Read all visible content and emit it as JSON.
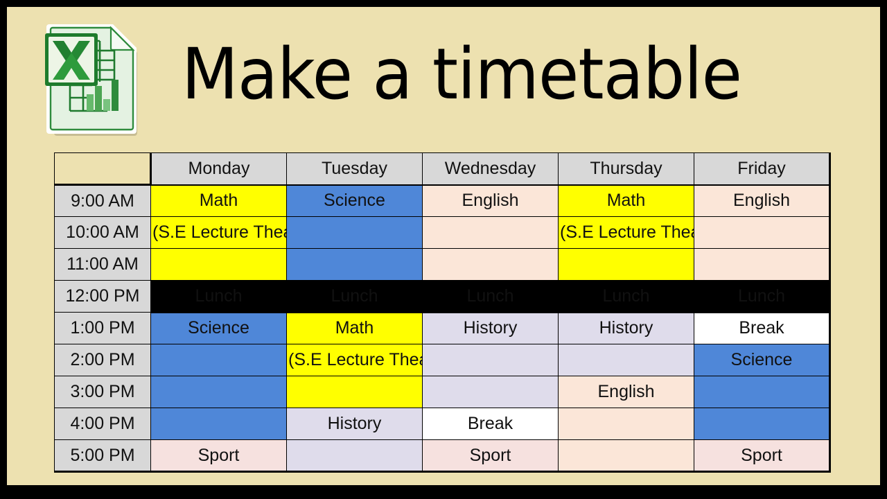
{
  "slide": {
    "background_color": "#EDE1B0",
    "frame_color": "#000000",
    "title": "Make a timetable",
    "logo_name": "excel-document-icon"
  },
  "legend_colors": {
    "math": "#FFFF00",
    "science": "#4F87D8",
    "english": "#FBE6D8",
    "history": "#DFDCEB",
    "sport": "#F6E1DF",
    "break": "#FFFFFF",
    "lunch": "#000000",
    "header": "#D8D8D8",
    "note_text": "#9AA67A"
  },
  "timetable": {
    "corner_label": "",
    "columns": [
      "Monday",
      "Tuesday",
      "Wednesday",
      "Thursday",
      "Friday"
    ],
    "times": [
      "9:00 AM",
      "10:00 AM",
      "11:00 AM",
      "12:00 PM",
      "1:00 PM",
      "2:00 PM",
      "3:00 PM",
      "4:00 PM",
      "5:00 PM"
    ],
    "note_text": "(S.E Lecture Theatre)",
    "rows": [
      {
        "time": "9:00 AM",
        "cells": [
          {
            "text": "Math",
            "subject": "math"
          },
          {
            "text": "Science",
            "subject": "science"
          },
          {
            "text": "English",
            "subject": "english"
          },
          {
            "text": "Math",
            "subject": "math"
          },
          {
            "text": "English",
            "subject": "english"
          }
        ]
      },
      {
        "time": "10:00 AM",
        "cells": [
          {
            "text": "(S.E Lecture Theatre)",
            "subject": "math",
            "note": true
          },
          {
            "text": "",
            "subject": "science"
          },
          {
            "text": "",
            "subject": "english"
          },
          {
            "text": "(S.E Lecture Theatre)",
            "subject": "math",
            "note": true
          },
          {
            "text": "",
            "subject": "english"
          }
        ]
      },
      {
        "time": "11:00 AM",
        "cells": [
          {
            "text": "",
            "subject": "math"
          },
          {
            "text": "",
            "subject": "science"
          },
          {
            "text": "",
            "subject": "english"
          },
          {
            "text": "",
            "subject": "math"
          },
          {
            "text": "",
            "subject": "english"
          }
        ]
      },
      {
        "time": "12:00 PM",
        "cells": [
          {
            "text": "Lunch",
            "subject": "lunch"
          },
          {
            "text": "Lunch",
            "subject": "lunch"
          },
          {
            "text": "Lunch",
            "subject": "lunch"
          },
          {
            "text": "Lunch",
            "subject": "lunch"
          },
          {
            "text": "Lunch",
            "subject": "lunch"
          }
        ]
      },
      {
        "time": "1:00 PM",
        "cells": [
          {
            "text": "Science",
            "subject": "science"
          },
          {
            "text": "Math",
            "subject": "math"
          },
          {
            "text": "History",
            "subject": "history"
          },
          {
            "text": "History",
            "subject": "history"
          },
          {
            "text": "Break",
            "subject": "break"
          }
        ]
      },
      {
        "time": "2:00 PM",
        "cells": [
          {
            "text": "",
            "subject": "science"
          },
          {
            "text": "(S.E Lecture Theatre)",
            "subject": "math",
            "note": true
          },
          {
            "text": "",
            "subject": "history"
          },
          {
            "text": "",
            "subject": "history"
          },
          {
            "text": "Science",
            "subject": "science"
          }
        ]
      },
      {
        "time": "3:00 PM",
        "cells": [
          {
            "text": "",
            "subject": "science"
          },
          {
            "text": "",
            "subject": "math"
          },
          {
            "text": "",
            "subject": "history"
          },
          {
            "text": "English",
            "subject": "english"
          },
          {
            "text": "",
            "subject": "science"
          }
        ]
      },
      {
        "time": "4:00 PM",
        "cells": [
          {
            "text": "",
            "subject": "science"
          },
          {
            "text": "History",
            "subject": "history"
          },
          {
            "text": "Break",
            "subject": "break"
          },
          {
            "text": "",
            "subject": "english"
          },
          {
            "text": "",
            "subject": "science"
          }
        ]
      },
      {
        "time": "5:00 PM",
        "cells": [
          {
            "text": "Sport",
            "subject": "sport"
          },
          {
            "text": "",
            "subject": "history"
          },
          {
            "text": "Sport",
            "subject": "sport"
          },
          {
            "text": "",
            "subject": "english"
          },
          {
            "text": "Sport",
            "subject": "sport"
          }
        ]
      }
    ]
  }
}
